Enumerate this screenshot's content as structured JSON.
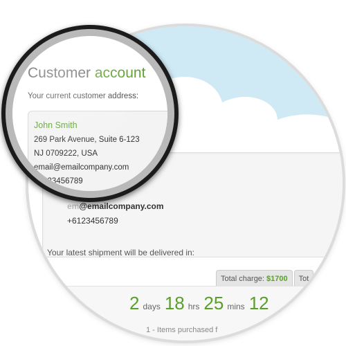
{
  "header": {
    "title_part1": "Customer",
    "title_part2": "account",
    "subtitle": "Your current customer address:"
  },
  "address": {
    "name": "John Smith",
    "street": "269 Park Avenue, Suite 6-123",
    "region": "NJ 0709222, USA",
    "email": "email@emailcompany.com",
    "phone": "+6123456789",
    "email_partial_hidden": "email@emailcompany.com",
    "phone_partial": "+6123456789",
    "phone_fragment": "123456789",
    "email_fragment": "@emailcompany.com"
  },
  "shipment": {
    "intro": "Your latest shipment will be delivered in:",
    "tab_charge_label": "Total charge:",
    "tab_charge_value": "$1700",
    "tab_second_label": "Tot",
    "countdown": {
      "days_value": "2",
      "days_label": "days",
      "hours_value": "18",
      "hours_label": "hrs",
      "mins_value": "25",
      "mins_label": "mins",
      "secs_value": "12"
    },
    "items_line": "1 - Items purchased f"
  },
  "colors": {
    "accent": "#5a9e2b",
    "sky": "#cfe9f5"
  }
}
